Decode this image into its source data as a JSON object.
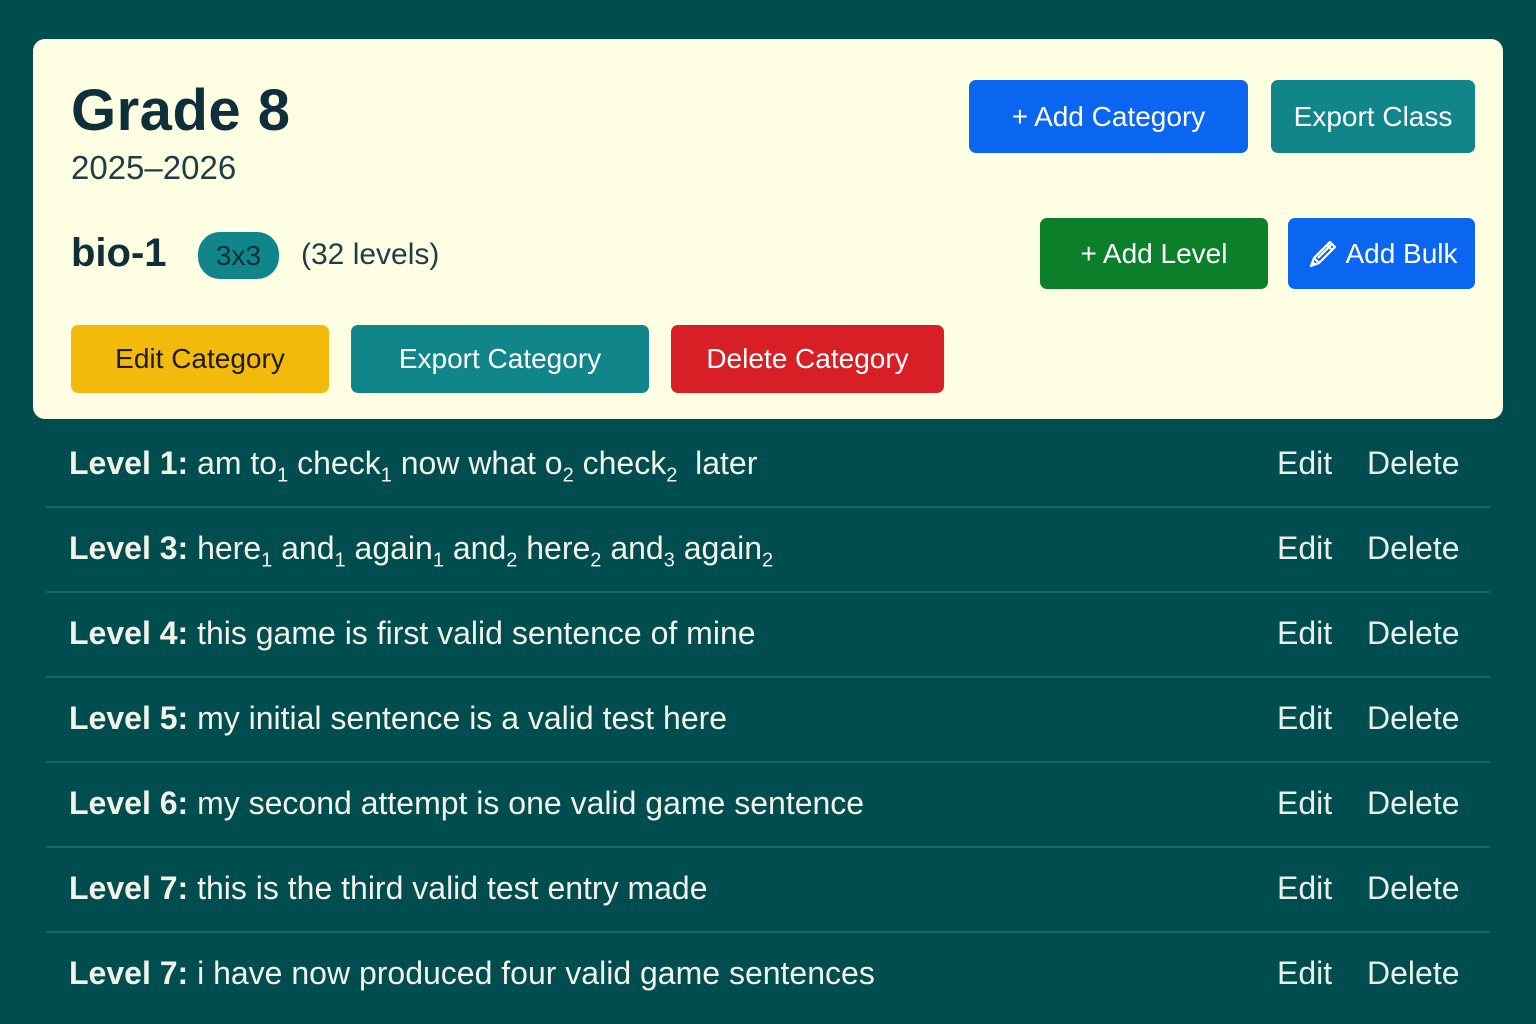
{
  "class": {
    "title": "Grade 8",
    "year": "2025–2026"
  },
  "header_actions": {
    "add_category_glyph": "+",
    "add_category_label": "Add Category",
    "export_class_label": "Export Class"
  },
  "category": {
    "name": "bio-1",
    "grid_badge": "3x3",
    "level_count": "(32 levels)",
    "add_level_glyph": "+",
    "add_level_label": "Add Level",
    "add_bulk_icon": "pencil-icon",
    "add_bulk_label": "Add Bulk",
    "edit_label": "Edit Category",
    "export_label": "Export Category",
    "delete_label": "Delete Category"
  },
  "colors": {
    "background": "#004d4f",
    "card": "#fefee3",
    "primary_blue": "#0a66f0",
    "teal": "#10868a",
    "green": "#0b7f2a",
    "yellow": "#f3b90b",
    "red": "#d91f26"
  },
  "levels": [
    {
      "label": "Level 1:",
      "segments": [
        {
          "t": " am to"
        },
        {
          "s": "1"
        },
        {
          "t": " check"
        },
        {
          "s": "1"
        },
        {
          "t": " now what o"
        },
        {
          "s": "2"
        },
        {
          "t": " check"
        },
        {
          "s": "2"
        },
        {
          "t": "  later"
        }
      ],
      "edit": "Edit",
      "delete": "Delete"
    },
    {
      "label": "Level 3:",
      "segments": [
        {
          "t": " here"
        },
        {
          "s": "1"
        },
        {
          "t": " and"
        },
        {
          "s": "1"
        },
        {
          "t": " again"
        },
        {
          "s": "1"
        },
        {
          "t": " and"
        },
        {
          "s": "2"
        },
        {
          "t": " here"
        },
        {
          "s": "2"
        },
        {
          "t": " and"
        },
        {
          "s": "3"
        },
        {
          "t": " again"
        },
        {
          "s": "2"
        }
      ],
      "edit": "Edit",
      "delete": "Delete"
    },
    {
      "label": "Level 4:",
      "segments": [
        {
          "t": " this game is first valid sentence of mine"
        }
      ],
      "edit": "Edit",
      "delete": "Delete"
    },
    {
      "label": "Level 5:",
      "segments": [
        {
          "t": " my initial sentence is a valid test here"
        }
      ],
      "edit": "Edit",
      "delete": "Delete"
    },
    {
      "label": "Level 6:",
      "segments": [
        {
          "t": " my second attempt is one valid game sentence"
        }
      ],
      "edit": "Edit",
      "delete": "Delete"
    },
    {
      "label": "Level 7:",
      "segments": [
        {
          "t": " this is the third valid test entry made"
        }
      ],
      "edit": "Edit",
      "delete": "Delete"
    },
    {
      "label": "Level 7:",
      "segments": [
        {
          "t": " i have now produced four valid game sentences"
        }
      ],
      "edit": "Edit",
      "delete": "Delete"
    }
  ]
}
